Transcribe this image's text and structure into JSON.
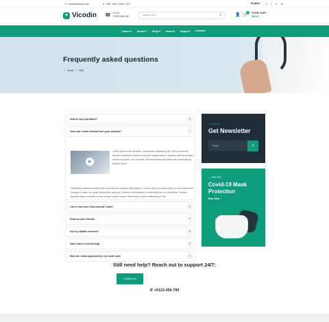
{
  "topbar": {
    "email": "info@webmail.com",
    "address": "15/K, New Yoren, NYC",
    "language": "English",
    "socials": [
      "facebook-icon",
      "twitter-icon",
      "vimeo-icon",
      "linkedin-icon"
    ]
  },
  "header": {
    "brand": "Vicodin",
    "phone_label": "Phone",
    "phone_number": "+0123-456-789",
    "search_placeholder": "Search here...",
    "cart_title": "YOUR CART",
    "cart_price": "$00.01",
    "cart_count": "0"
  },
  "nav": [
    "Home",
    "About",
    "Shop",
    "News",
    "Pages",
    "Contact"
  ],
  "hero": {
    "title": "Frequently asked questions",
    "crumb_home": "Home",
    "crumb_current": "FAQ"
  },
  "faq": {
    "items": [
      {
        "q": "How to buy a product?",
        "icon": "+"
      },
      {
        "q": "How can i make refund from your website?",
        "icon": "−"
      },
      {
        "q": "I am a new user. How should I start?",
        "icon": "+"
      },
      {
        "q": "Returns and refunds",
        "icon": "+"
      },
      {
        "q": "Are my details secured?",
        "icon": "+"
      },
      {
        "q": "Sale code is not working",
        "icon": "+"
      },
      {
        "q": "How do I make payment by my credit card",
        "icon": "+"
      }
    ],
    "answer_text_1": "Lorem ipsum dolor sit amet, consectetur adipiscing elit, sed do eiusmod tempor incididunt ut labore et dolore magna aliqua. Quisque placerat feugiat mauris at ipsum, ut in sit amet. Sit amet mattis vulputate enim nulla aliquet porttitor lacus.",
    "answer_text_2": "Phasellus vestibulum lorem sed risus ultricies tristique nulla aliquet. Lectus nulla at volutpat diam ut venenatis tellus. Quisque id diam vel quam elementum pulvinar. Gravida in fermentum et sollicitudin ac orci phasellus. Facilisis gravida neque convallis a cras semper auctor neque vitae tempus quam pellentesque nec."
  },
  "newsletter": {
    "subtitle": "// subscribe",
    "title": "Get Newsletter",
    "input_placeholder": "Email"
  },
  "promo": {
    "discount": "— 20% OFF",
    "title": "Covid-19 Mask Protection",
    "cta": "Buy Now"
  },
  "support": {
    "heading": "Still need help? Reach out to support 24/7:",
    "button": "Contact Us",
    "phone": "+0123-456-789"
  },
  "colors": {
    "accent": "#0e9d7a",
    "dark": "#1f2e36",
    "hero_bg": "#d3e5ec"
  }
}
